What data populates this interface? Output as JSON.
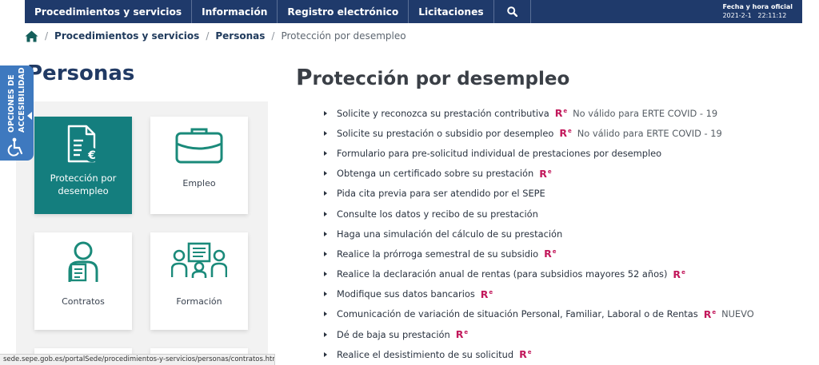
{
  "nav": {
    "items": [
      "Procedimientos y servicios",
      "Información",
      "Registro electrónico",
      "Licitaciones"
    ],
    "search_icon": "search-icon"
  },
  "datetime": {
    "label": "Fecha y hora oficial",
    "date": "2021-2-1",
    "time": "22:11:12"
  },
  "breadcrumb": {
    "home_icon": "home-icon",
    "items": [
      "Procedimientos y servicios",
      "Personas"
    ],
    "current": "Protección por desempleo"
  },
  "accessibility": {
    "line1": "OPCIONES DE",
    "line2": "ACCESIBILIDAD",
    "icon": "wheelchair-icon"
  },
  "left": {
    "title": "Personas",
    "cards": [
      {
        "label_line1": "Protección por",
        "label_line2": "desempleo",
        "icon": "document-euro-icon",
        "active": true
      },
      {
        "label_line1": "Empleo",
        "label_line2": "",
        "icon": "briefcase-icon",
        "active": false
      },
      {
        "label_line1": "Contratos",
        "label_line2": "",
        "icon": "person-contract-icon",
        "active": false
      },
      {
        "label_line1": "Formación",
        "label_line2": "",
        "icon": "training-icon",
        "active": false
      }
    ]
  },
  "main": {
    "title_first": "P",
    "title_rest": "rotección por desempleo",
    "items": [
      {
        "text": "Solicite y reconozca su prestación contributiva",
        "re": true,
        "note": "No válido para ERTE COVID - 19"
      },
      {
        "text": "Solicite su prestación o subsidio por desempleo",
        "re": true,
        "note": "No válido para ERTE COVID - 19"
      },
      {
        "text": "Formulario para pre-solicitud individual de prestaciones por desempleo",
        "re": false,
        "note": ""
      },
      {
        "text": "Obtenga un certificado sobre su prestación",
        "re": true,
        "note": ""
      },
      {
        "text": "Pida cita previa para ser atendido por el SEPE",
        "re": false,
        "note": ""
      },
      {
        "text": "Consulte los datos y recibo de su prestación",
        "re": false,
        "note": ""
      },
      {
        "text": "Haga una simulación del cálculo de su prestación",
        "re": false,
        "note": ""
      },
      {
        "text": "Realice la prórroga semestral de su subsidio",
        "re": true,
        "note": ""
      },
      {
        "text": "Realice la declaración anual de rentas (para subsidios mayores 52 años)",
        "re": true,
        "note": ""
      },
      {
        "text": "Modifique sus datos bancarios",
        "re": true,
        "note": ""
      },
      {
        "text": "Comunicación de variación de situación Personal, Familiar, Laboral o de Rentas",
        "re": true,
        "note": "NUEVO"
      },
      {
        "text": "Dé de baja su prestación",
        "re": true,
        "note": ""
      },
      {
        "text": "Realice el desistimiento de su solicitud",
        "re": true,
        "note": ""
      }
    ],
    "re_main": "R",
    "re_sup": "e"
  },
  "status_bar": {
    "url": "sede.sepe.gob.es/portalSede/procedimientos-y-servicios/personas/contratos.html"
  },
  "colors": {
    "nav": "#1f3a6b",
    "teal": "#147e7e",
    "accent_re": "#c2185b",
    "a11y": "#3e79bf"
  }
}
